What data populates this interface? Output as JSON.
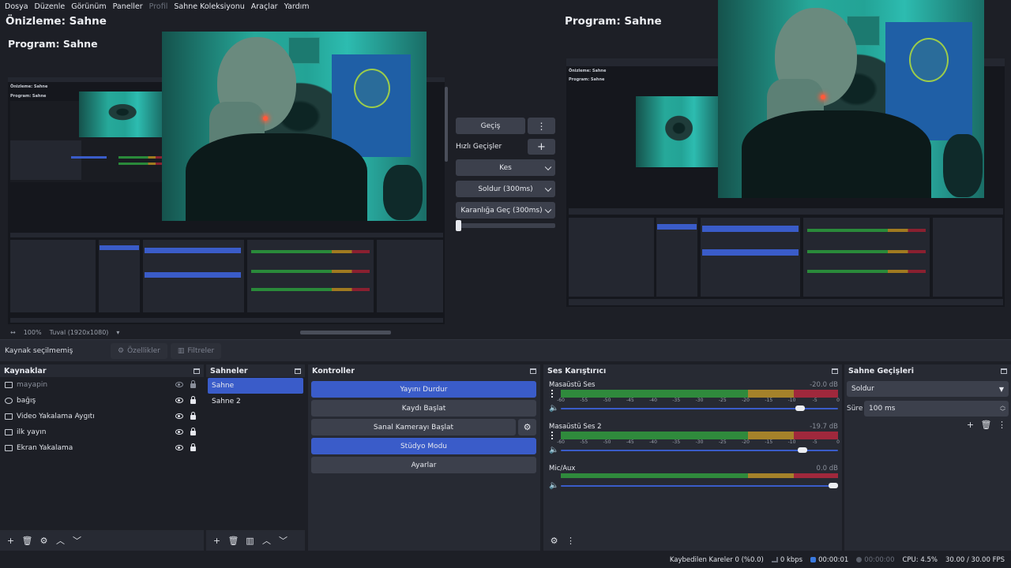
{
  "menu": {
    "items": [
      "Dosya",
      "Düzenle",
      "Görünüm",
      "Paneller",
      "Profil",
      "Sahne Koleksiyonu",
      "Araçlar",
      "Yardım"
    ]
  },
  "preview": {
    "label": "Önizleme: Sahne",
    "inner_label": "Program: Sahne",
    "zoom": "100%",
    "canvas": "Tuval (1920x1080)"
  },
  "program": {
    "label": "Program: Sahne"
  },
  "transitions_panel": {
    "transition_button": "Geçiş",
    "quick_label": "Hızlı Geçişler",
    "quick": [
      "Kes",
      "Soldur (300ms)",
      "Karanlığa Geç (300ms)"
    ]
  },
  "context_bar": {
    "no_source": "Kaynak seçilmemiş",
    "properties": "Özellikler",
    "filters": "Filtreler"
  },
  "sources": {
    "title": "Kaynaklar",
    "items": [
      {
        "name": "mayapin",
        "visible": false
      },
      {
        "name": "bağış",
        "visible": true
      },
      {
        "name": "Video Yakalama Aygıtı",
        "visible": true
      },
      {
        "name": "ilk yayın",
        "visible": true
      },
      {
        "name": "Ekran Yakalama",
        "visible": true
      }
    ]
  },
  "scenes": {
    "title": "Sahneler",
    "items": [
      "Sahne",
      "Sahne 2"
    ],
    "selected": 0
  },
  "controls": {
    "title": "Kontroller",
    "stop_stream": "Yayını Durdur",
    "start_record": "Kaydı Başlat",
    "virtual_cam": "Sanal Kamerayı Başlat",
    "studio_mode": "Stüdyo Modu",
    "settings": "Ayarlar"
  },
  "mixer": {
    "title": "Ses Karıştırıcı",
    "ticks": [
      "-60",
      "-55",
      "-50",
      "-45",
      "-40",
      "-35",
      "-30",
      "-25",
      "-20",
      "-15",
      "-10",
      "-5",
      "0"
    ],
    "channels": [
      {
        "name": "Masaüstü Ses",
        "db": "-20.0 dB",
        "volume": 0.88
      },
      {
        "name": "Masaüstü Ses 2",
        "db": "-19.7 dB",
        "volume": 0.89
      },
      {
        "name": "Mic/Aux",
        "db": "0.0 dB",
        "volume": 1.0
      }
    ]
  },
  "scene_transitions": {
    "title": "Sahne Geçişleri",
    "selected": "Soldur",
    "duration_label": "Süre",
    "duration_value": "100 ms"
  },
  "status": {
    "dropped": "Kaybedilen Kareler 0 (%0.0)",
    "bitrate": "0 kbps",
    "stream_time": "00:00:01",
    "rec_time": "00:00:00",
    "cpu": "CPU: 4.5%",
    "fps": "30.00 / 30.00 FPS"
  },
  "colors": {
    "accent": "#3a5cc9",
    "bg": "#1d1f26",
    "panel": "#272a33"
  }
}
